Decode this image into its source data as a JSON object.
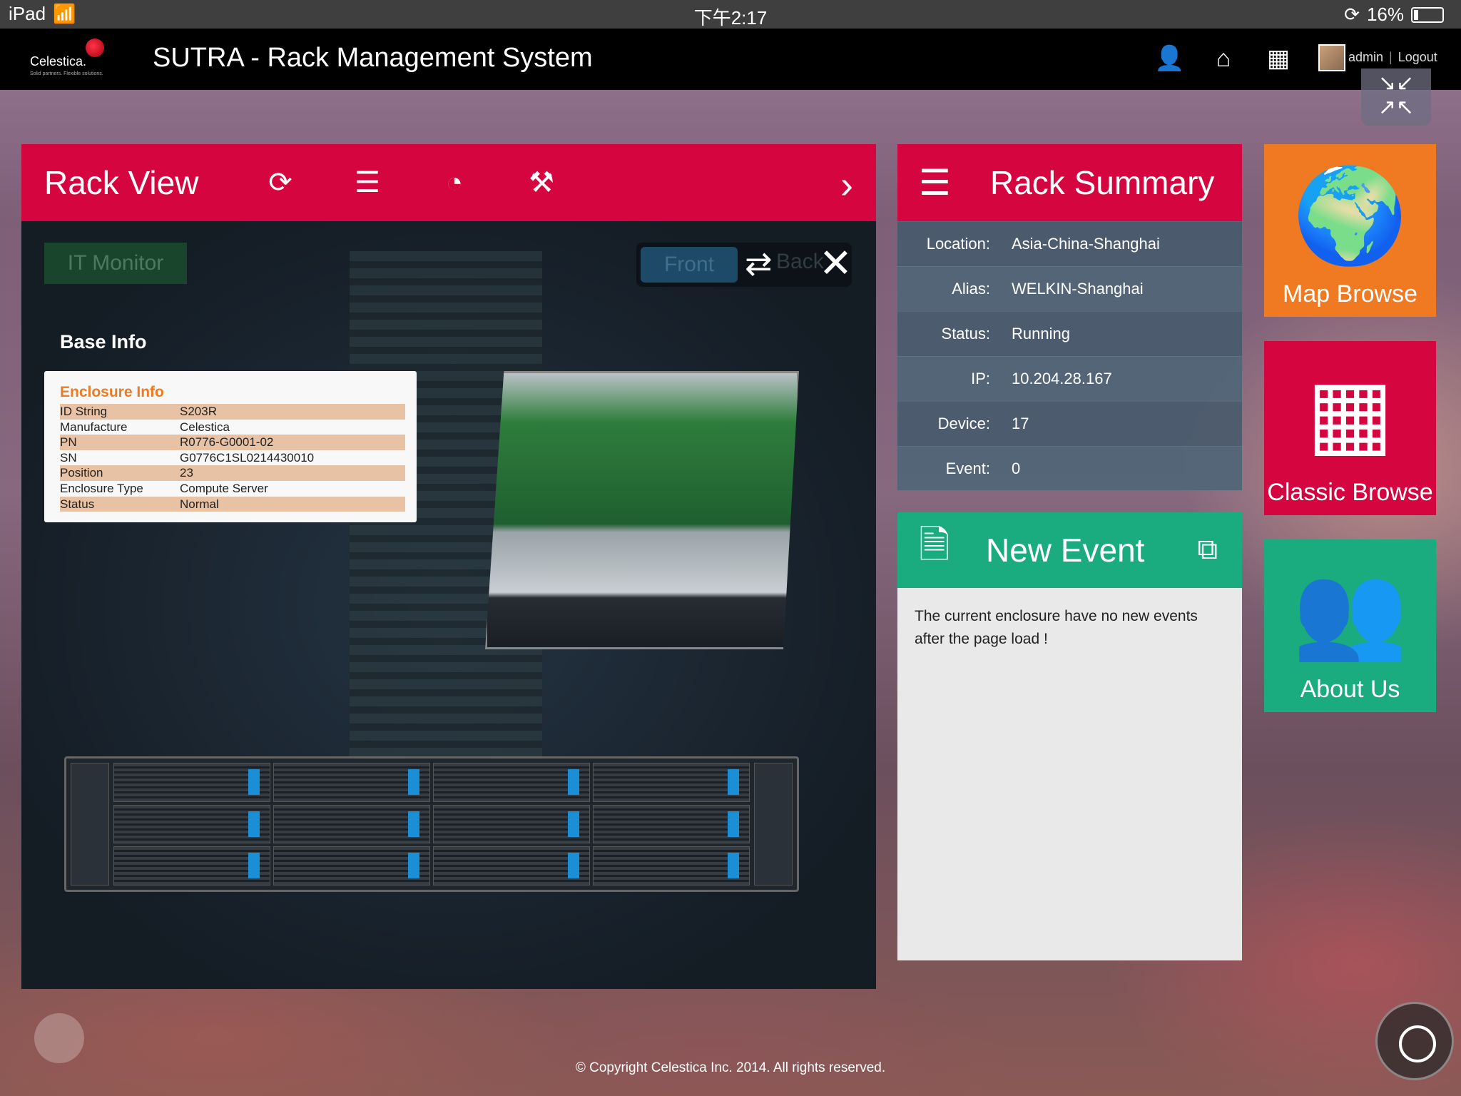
{
  "statusbar": {
    "device": "iPad",
    "time": "下午2:17",
    "battery": "16%"
  },
  "header": {
    "logo": "Celestica.",
    "logo_tagline": "Solid partners. Flexible solutions.",
    "title": "SUTRA - Rack Management System",
    "username": "admin",
    "logout": "Logout",
    "icons": [
      "user-icon",
      "home-icon",
      "apps-grid-icon"
    ]
  },
  "rack_view": {
    "title": "Rack View",
    "toolbar_icons": [
      "refresh-icon",
      "list-icon",
      "dashboard-icon",
      "tools-icon"
    ],
    "it_monitor": "IT Monitor",
    "front": "Front",
    "back": "Back",
    "base_info": "Base Info",
    "enclosure": {
      "title": "Enclosure Info",
      "rows": [
        {
          "k": "ID String",
          "v": "S203R"
        },
        {
          "k": "Manufacture",
          "v": "Celestica"
        },
        {
          "k": "PN",
          "v": "R0776-G0001-02"
        },
        {
          "k": "SN",
          "v": "G0776C1SL0214430010"
        },
        {
          "k": "Position",
          "v": "23"
        },
        {
          "k": "Enclosure Type",
          "v": "Compute Server"
        },
        {
          "k": "Status",
          "v": "Normal"
        }
      ]
    }
  },
  "rack_summary": {
    "title": "Rack Summary",
    "rows": [
      {
        "k": "Location:",
        "v": "Asia-China-Shanghai"
      },
      {
        "k": "Alias:",
        "v": "WELKIN-Shanghai"
      },
      {
        "k": "Status:",
        "v": "Running"
      },
      {
        "k": "IP:",
        "v": "10.204.28.167"
      },
      {
        "k": "Device:",
        "v": "17"
      },
      {
        "k": "Event:",
        "v": "0"
      }
    ]
  },
  "new_event": {
    "title": "New Event",
    "message": "The current enclosure have no new events after the page load !"
  },
  "tiles": {
    "map": "Map Browse",
    "classic": "Classic Browse",
    "about": "About Us"
  },
  "footer": "© Copyright Celestica Inc. 2014. All rights reserved.",
  "colors": {
    "red": "#d5063f",
    "orange": "#f07a22",
    "green": "#1aab7f"
  }
}
